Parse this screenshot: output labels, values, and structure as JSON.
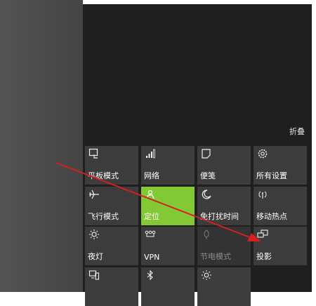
{
  "action_center": {
    "collapse_label": "折叠",
    "tiles": [
      {
        "label": "平板模式",
        "icon": "tablet-mode-icon"
      },
      {
        "label": "网络",
        "icon": "network-icon"
      },
      {
        "label": "便笺",
        "icon": "note-icon"
      },
      {
        "label": "所有设置",
        "icon": "settings-gear-icon"
      },
      {
        "label": "飞行模式",
        "icon": "airplane-icon"
      },
      {
        "label": "定位",
        "icon": "location-icon",
        "active": true
      },
      {
        "label": "免打扰时间",
        "icon": "quiet-hours-moon-icon"
      },
      {
        "label": "移动热点",
        "icon": "mobile-hotspot-icon"
      },
      {
        "label": "夜灯",
        "icon": "night-light-icon"
      },
      {
        "label": "VPN",
        "icon": "vpn-icon"
      },
      {
        "label": "节电模式",
        "icon": "battery-saver-icon",
        "disabled": true
      },
      {
        "label": "投影",
        "icon": "project-icon"
      },
      {
        "label": "",
        "icon": "connect-icon"
      },
      {
        "label": "",
        "icon": "bluetooth-icon"
      },
      {
        "label": "",
        "icon": "brightness-icon"
      }
    ]
  },
  "colors": {
    "active_tile": "#83c935",
    "tile": "#3c3c3c",
    "panel": "#1f1f1f",
    "annotation_arrow": "#d42020"
  }
}
